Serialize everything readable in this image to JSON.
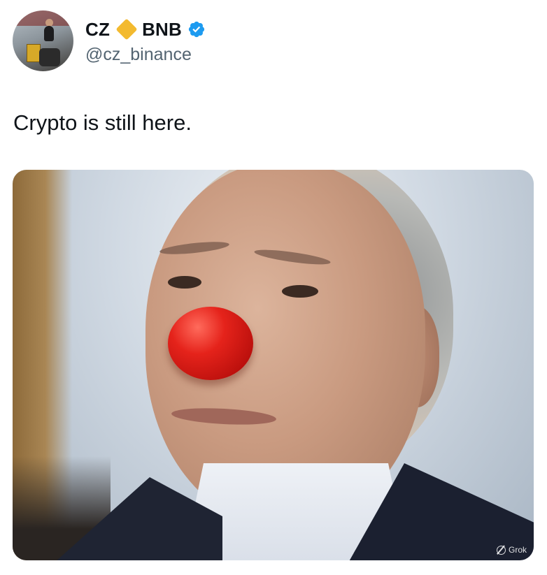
{
  "author": {
    "display_name_first": "CZ",
    "display_name_last": "BNB",
    "handle": "@cz_binance",
    "verified_color": "#1d9bf0",
    "bnb_icon_color": "#f3ba2f"
  },
  "tweet": {
    "text": "Crypto is still here."
  },
  "media": {
    "watermark": "Grok"
  }
}
